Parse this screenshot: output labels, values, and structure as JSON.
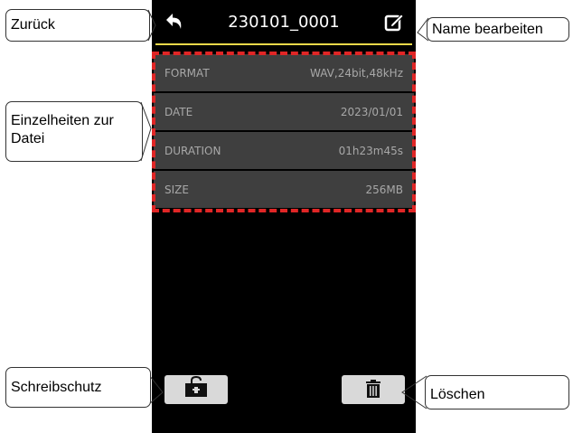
{
  "screen": {
    "title": "230101_0001",
    "details": [
      {
        "label": "FORMAT",
        "value": "WAV,24bit,48kHz"
      },
      {
        "label": "DATE",
        "value": "2023/01/01"
      },
      {
        "label": "DURATION",
        "value": "01h23m45s"
      },
      {
        "label": "SIZE",
        "value": "256MB"
      }
    ],
    "accent_color": "#e8d84a",
    "highlight_color": "#e02626"
  },
  "callouts": {
    "back": "Zurück",
    "rename": "Name bearbeiten",
    "details_line1": "Einzelheiten zur",
    "details_line2": "Datei",
    "protect": "Schreibschutz",
    "delete": "Löschen"
  },
  "icons": {
    "back": "back-arrow-icon",
    "rename": "edit-icon",
    "protect": "unlock-icon",
    "delete": "trash-icon"
  }
}
